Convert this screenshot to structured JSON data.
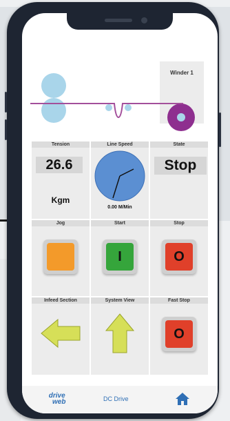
{
  "winder": {
    "label": "Winder 1"
  },
  "tension": {
    "header": "Tension",
    "value": "26.6",
    "unit": "Kgm"
  },
  "line_speed": {
    "header": "Line Speed",
    "value": "0.00 M/Min"
  },
  "state": {
    "header": "State",
    "value": "Stop"
  },
  "jog": {
    "header": "Jog",
    "color": "#f39a2a"
  },
  "start": {
    "header": "Start",
    "glyph": "I",
    "color": "#35a53b"
  },
  "stop": {
    "header": "Stop",
    "glyph": "O",
    "color": "#e0402a"
  },
  "infeed": {
    "header": "Infeed Section"
  },
  "system_view": {
    "header": "System View"
  },
  "fast_stop": {
    "header": "Fast Stop",
    "glyph": "O"
  },
  "footer": {
    "logo_top": "drive",
    "logo_bottom": "web",
    "center_label": "DC Drive"
  },
  "colors": {
    "accent": "#2f6fb5",
    "arrow_fill": "#d6df58",
    "gauge": "#5b8fd2",
    "roller": "#a9d5ea",
    "web_line": "#a34f9b"
  },
  "icons": [
    "home-icon",
    "left-arrow-icon",
    "up-arrow-icon"
  ]
}
